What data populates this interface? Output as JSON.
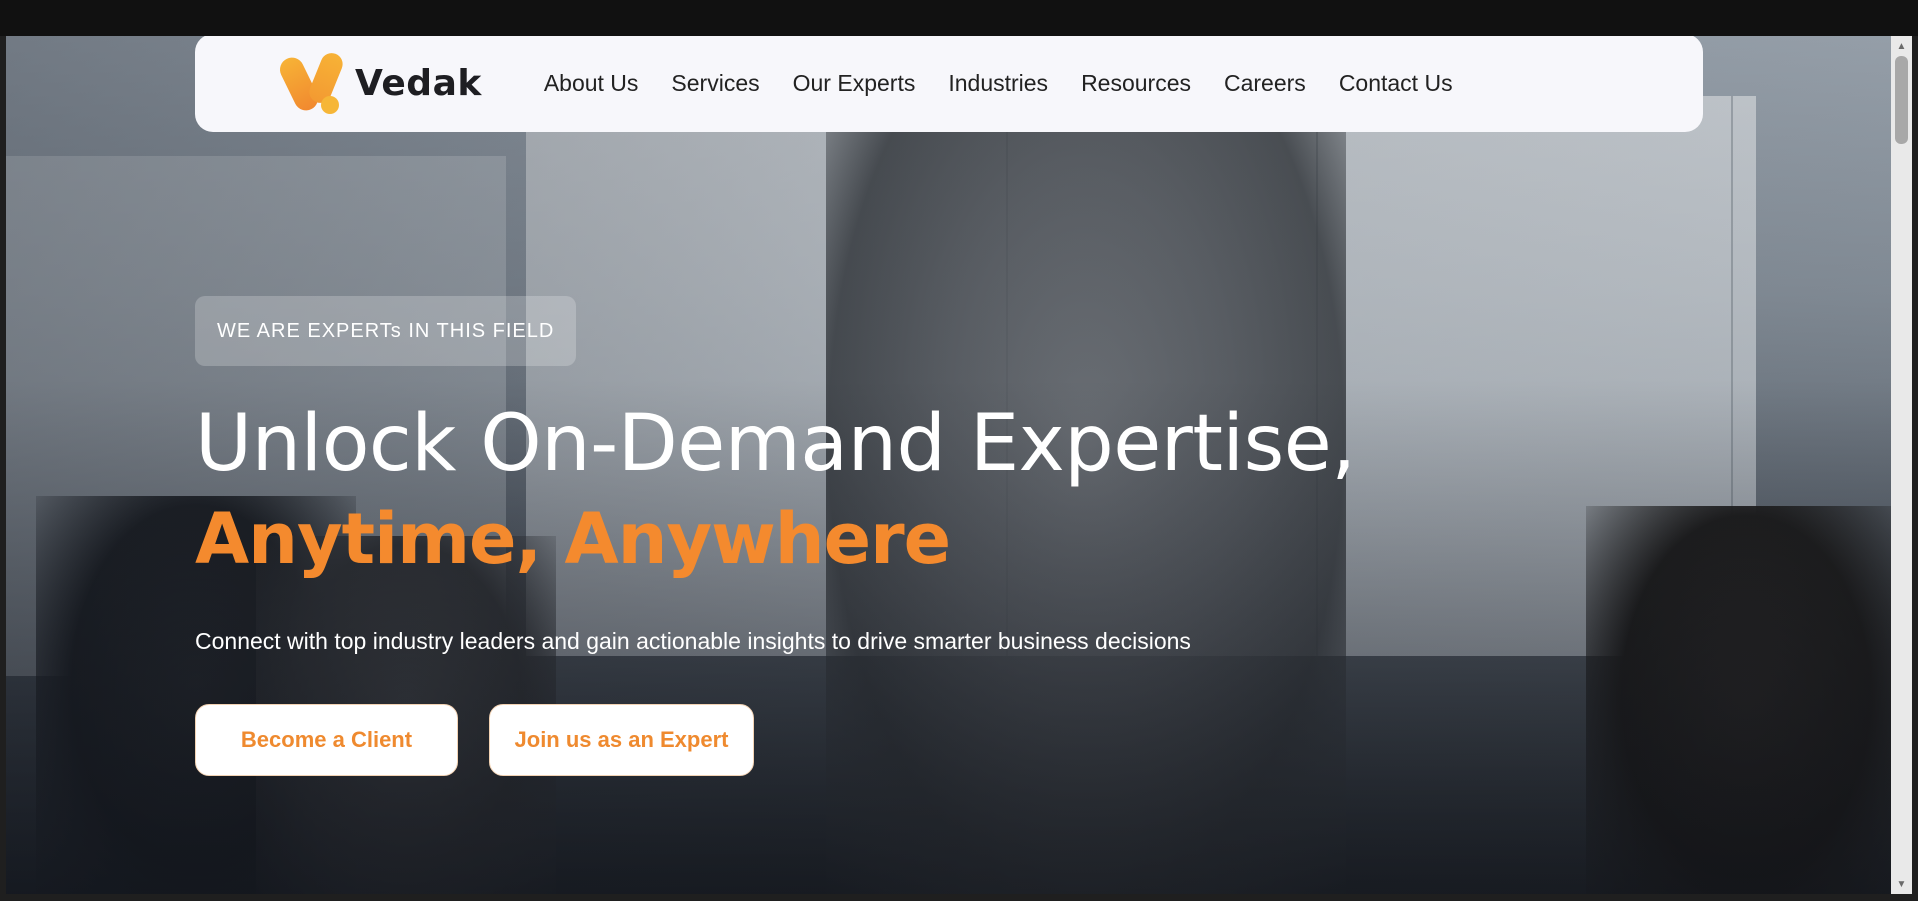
{
  "brand": {
    "name": "Vedak",
    "accent_color": "#f48a2e"
  },
  "nav": {
    "items": [
      {
        "label": "About Us"
      },
      {
        "label": "Services"
      },
      {
        "label": "Our Experts"
      },
      {
        "label": "Industries"
      },
      {
        "label": "Resources"
      },
      {
        "label": "Careers"
      },
      {
        "label": "Contact Us"
      }
    ]
  },
  "hero": {
    "eyebrow": "WE ARE EXPERTs IN THIS FIELD",
    "headline": "Unlock On-Demand Expertise,",
    "headline_accent": "Anytime, Anywhere",
    "subtext": "Connect with top industry leaders and gain actionable insights to drive smarter business decisions",
    "primary_button": "Become a Client",
    "secondary_button": "Join us as an Expert"
  },
  "scrollbar": {
    "up_icon": "▲",
    "down_icon": "▼"
  }
}
